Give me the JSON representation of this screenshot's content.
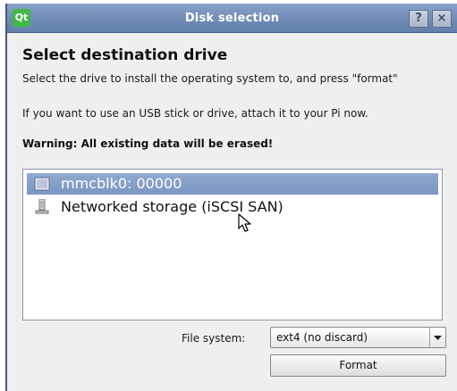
{
  "window": {
    "title": "Disk selection",
    "logo_text": "Qt",
    "help_label": "?",
    "close_label": "×"
  },
  "dialog": {
    "heading": "Select destination drive",
    "instruction": "Select the drive to install the operating system to, and press \"format\"",
    "usb_hint": "If you want to use an USB stick or drive, attach it to your Pi now.",
    "warning": "Warning: All existing data will be erased!"
  },
  "drives": [
    {
      "label": "mmcblk0: 00000",
      "icon": "sd-card-icon",
      "selected": true
    },
    {
      "label": "Networked storage (iSCSI SAN)",
      "icon": "network-storage-icon",
      "selected": false
    }
  ],
  "filesystem": {
    "label": "File system:",
    "selected": "ext4 (no discard)"
  },
  "actions": {
    "format_label": "Format"
  },
  "colors": {
    "titlebar": "#6f8bb6",
    "selection": "#7b97c2",
    "qt_green": "#41b947"
  }
}
